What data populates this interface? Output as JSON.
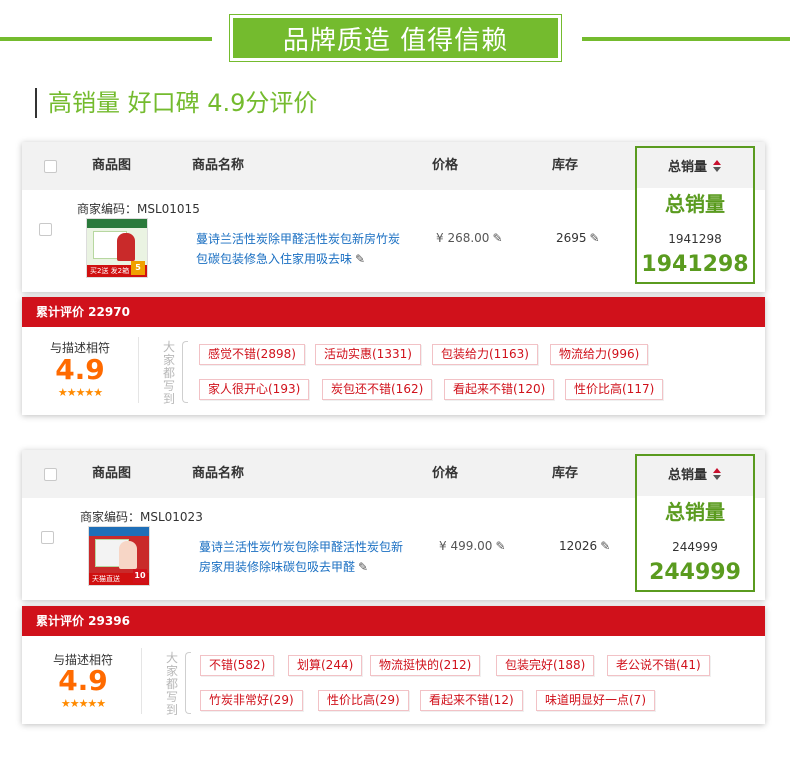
{
  "banner": {
    "title": "品牌质造 值得信赖"
  },
  "subtitle": "高销量 好口碑 4.9分评价",
  "colors": {
    "accent_green": "#74bb2e",
    "sales_green": "#5a9b1f",
    "review_red": "#d0111b",
    "score_orange": "#ff6a00",
    "link_blue": "#1a6fc2"
  },
  "table_header": {
    "image": "商品图",
    "name": "商品名称",
    "price": "价格",
    "stock": "库存",
    "sales": "总销量"
  },
  "products": [
    {
      "sku": "商家编码：MSL01015",
      "name": "蔓诗兰活性炭除甲醛活性炭包新房竹炭包碳包装修急入住家用吸去味",
      "price": "¥ 268.00",
      "stock": "2695",
      "sales_label": "总销量",
      "sales_small": "1941298",
      "sales_big": "1941298",
      "thumb": {
        "bar_text": "买2送 发2箱",
        "badge": "5"
      },
      "reviews": {
        "title": "累计评价 22970",
        "desc_label": "与描述相符",
        "score": "4.9",
        "stars": "★★★★★",
        "everyone_says": "大家都写到",
        "tags": [
          "感觉不错(2898)",
          "活动实惠(1331)",
          "包装给力(1163)",
          "物流给力(996)",
          "家人很开心(193)",
          "炭包还不错(162)",
          "看起来不错(120)",
          "性价比高(117)"
        ]
      }
    },
    {
      "sku": "商家编码：MSL01023",
      "name": "蔓诗兰活性炭竹炭包除甲醛活性炭包新房家用装修除味碳包吸去甲醛",
      "price": "¥ 499.00",
      "stock": "12026",
      "sales_label": "总销量",
      "sales_small": "244999",
      "sales_big": "244999",
      "thumb": {
        "bar_text": "天猫直送",
        "badge": "10"
      },
      "reviews": {
        "title": "累计评价 29396",
        "desc_label": "与描述相符",
        "score": "4.9",
        "stars": "★★★★★",
        "everyone_says": "大家都写到",
        "tags": [
          "不错(582)",
          "划算(244)",
          "物流挺快的(212)",
          "包装完好(188)",
          "老公说不错(41)",
          "竹炭非常好(29)",
          "性价比高(29)",
          "看起来不错(12)",
          "味道明显好一点(7)"
        ]
      }
    }
  ]
}
